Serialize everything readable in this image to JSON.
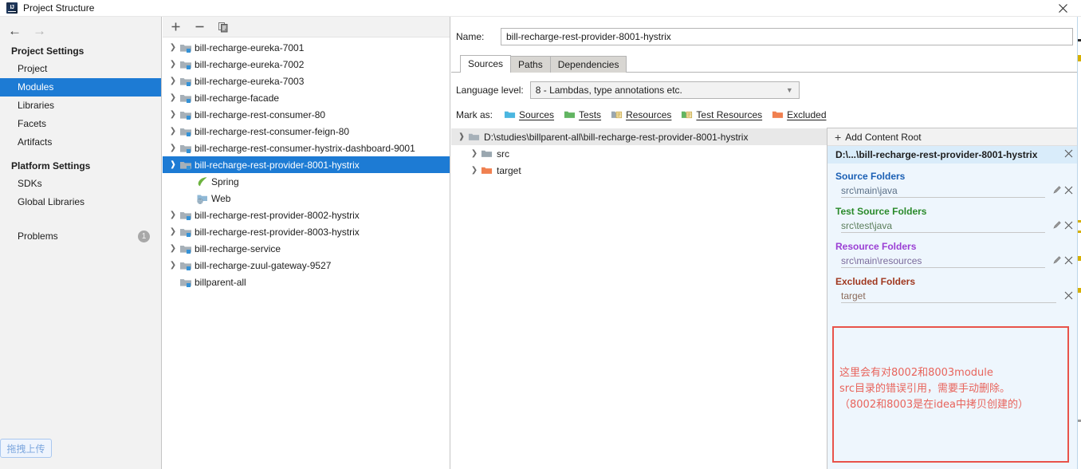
{
  "window": {
    "title": "Project Structure",
    "app_icon": "intellij-idea-icon",
    "close_icon": "close-icon"
  },
  "sidebar": {
    "back_icon": "arrow-left-icon",
    "forward_icon": "arrow-right-icon",
    "groups": [
      {
        "title": "Project Settings",
        "items": [
          {
            "label": "Project",
            "selected": false
          },
          {
            "label": "Modules",
            "selected": true
          },
          {
            "label": "Libraries",
            "selected": false
          },
          {
            "label": "Facets",
            "selected": false
          },
          {
            "label": "Artifacts",
            "selected": false
          }
        ]
      },
      {
        "title": "Platform Settings",
        "items": [
          {
            "label": "SDKs",
            "selected": false
          },
          {
            "label": "Global Libraries",
            "selected": false
          }
        ]
      }
    ],
    "problems": {
      "label": "Problems",
      "count": "1"
    },
    "drag_upload_chip": "拖拽上传"
  },
  "module_panel": {
    "toolbar": {
      "add_label": "+",
      "remove_label": "−",
      "copy_icon": "copy-icon"
    },
    "modules": [
      {
        "label": "bill-recharge-eureka-7001",
        "expanded": false,
        "selected": false,
        "child": false
      },
      {
        "label": "bill-recharge-eureka-7002",
        "expanded": false,
        "selected": false,
        "child": false
      },
      {
        "label": "bill-recharge-eureka-7003",
        "expanded": false,
        "selected": false,
        "child": false
      },
      {
        "label": "bill-recharge-facade",
        "expanded": false,
        "selected": false,
        "child": false
      },
      {
        "label": "bill-recharge-rest-consumer-80",
        "expanded": false,
        "selected": false,
        "child": false
      },
      {
        "label": "bill-recharge-rest-consumer-feign-80",
        "expanded": false,
        "selected": false,
        "child": false
      },
      {
        "label": "bill-recharge-rest-consumer-hystrix-dashboard-9001",
        "expanded": false,
        "selected": false,
        "child": false
      },
      {
        "label": "bill-recharge-rest-provider-8001-hystrix",
        "expanded": true,
        "selected": true,
        "child": false
      },
      {
        "label": "Spring",
        "icon": "spring-leaf-icon",
        "selected": false,
        "child": true
      },
      {
        "label": "Web",
        "icon": "web-facet-icon",
        "selected": false,
        "child": true
      },
      {
        "label": "bill-recharge-rest-provider-8002-hystrix",
        "expanded": false,
        "selected": false,
        "child": false
      },
      {
        "label": "bill-recharge-rest-provider-8003-hystrix",
        "expanded": false,
        "selected": false,
        "child": false
      },
      {
        "label": "bill-recharge-service",
        "expanded": false,
        "selected": false,
        "child": false
      },
      {
        "label": "bill-recharge-zuul-gateway-9527",
        "expanded": false,
        "selected": false,
        "child": false
      },
      {
        "label": "billparent-all",
        "expanded": null,
        "selected": false,
        "child": false
      }
    ]
  },
  "detail": {
    "name_label": "Name:",
    "name_value": "bill-recharge-rest-provider-8001-hystrix",
    "tabs": [
      {
        "label": "Sources",
        "active": true
      },
      {
        "label": "Paths",
        "active": false
      },
      {
        "label": "Dependencies",
        "active": false
      }
    ],
    "language_level_label": "Language level:",
    "language_level_value": "8 - Lambdas, type annotations etc.",
    "mark_as_label": "Mark as:",
    "mark_as_options": [
      {
        "label": "Sources",
        "color": "#4bb6e0",
        "icon": "sources-folder-icon"
      },
      {
        "label": "Tests",
        "color": "#62b562",
        "icon": "tests-folder-icon"
      },
      {
        "label": "Resources",
        "color": "#9aa7b0",
        "icon": "resources-folder-icon"
      },
      {
        "label": "Test Resources",
        "color": "#62b562",
        "icon": "test-resources-folder-icon"
      },
      {
        "label": "Excluded",
        "color": "#f08050",
        "icon": "excluded-folder-icon"
      }
    ],
    "content_root_tree": {
      "root": "D:\\studies\\billparent-all\\bill-recharge-rest-provider-8001-hystrix",
      "children": [
        {
          "label": "src",
          "folder_color": "#9aa7b0"
        },
        {
          "label": "target",
          "folder_color": "#f08050"
        }
      ]
    }
  },
  "right_panel": {
    "add_content_root": "Add Content Root",
    "add_content_root_prefix": "Add ",
    "add_content_root_accel": "C",
    "add_content_root_suffix": "ontent Root",
    "root_path": "D:\\...\\bill-recharge-rest-provider-8001-hystrix",
    "sections": [
      {
        "title": "Source Folders",
        "kind": "src",
        "folders": [
          {
            "path": "src\\main\\java",
            "has_edit": true,
            "has_remove": true
          }
        ]
      },
      {
        "title": "Test Source Folders",
        "kind": "test",
        "folders": [
          {
            "path": "src\\test\\java",
            "has_edit": true,
            "has_remove": true
          }
        ]
      },
      {
        "title": "Resource Folders",
        "kind": "res",
        "folders": [
          {
            "path": "src\\main\\resources",
            "has_edit": true,
            "has_remove": true
          }
        ]
      },
      {
        "title": "Excluded Folders",
        "kind": "excl",
        "folders": [
          {
            "path": "target",
            "has_edit": false,
            "has_remove": true
          }
        ]
      }
    ],
    "edit_icon": "pencil-icon",
    "remove_icon": "close-x-icon"
  },
  "annotation": {
    "border_color": "#e8534a",
    "text_color": "#e8645c",
    "lines": [
      "这里会有对8002和8003module",
      "src目录的错误引用，需要手动删除。",
      "（8002和8003是在idea中拷贝创建的）"
    ]
  }
}
